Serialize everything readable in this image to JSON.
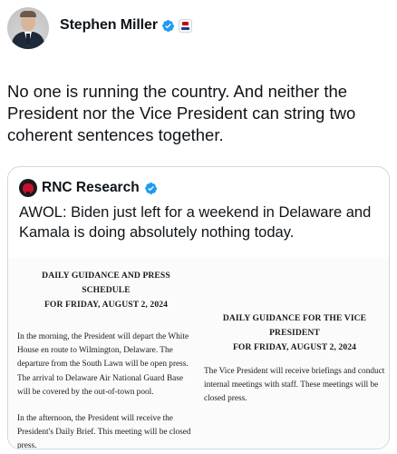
{
  "post": {
    "author": "Stephen Miller",
    "verified_icon": "verified-badge-icon",
    "affiliation_icon": "flag-affiliation-icon",
    "text": "No one is running the country. And neither the President nor the Vice President can string two coherent sentences together."
  },
  "quote": {
    "author": "RNC Research",
    "verified_icon": "verified-badge-icon",
    "text": "AWOL: Biden just left for a weekend in Delaware and Kamala is doing absolutely nothing today.",
    "document": {
      "left": {
        "heading_line1": "DAILY GUIDANCE AND PRESS",
        "heading_line2": "SCHEDULE",
        "heading_line3": "FOR FRIDAY, AUGUST 2, 2024",
        "para1": "In the morning, the President will depart the White House en route to Wilmington, Delaware. The departure from the South Lawn will be open press. The arrival to Delaware Air National Guard Base will be covered by the out-of-town pool.",
        "para2": "In the afternoon, the President will receive the President's Daily Brief. This meeting will be closed press."
      },
      "right": {
        "heading_line1": "DAILY GUIDANCE FOR THE VICE",
        "heading_line2": "PRESIDENT",
        "heading_line3": "FOR FRIDAY, AUGUST 2, 2024",
        "para1": "The Vice President will receive briefings and conduct internal meetings with staff. These meetings will be closed press."
      }
    }
  },
  "colors": {
    "text": "#0f1419",
    "verified_blue": "#1d9bf0",
    "border": "#cfd9de"
  }
}
